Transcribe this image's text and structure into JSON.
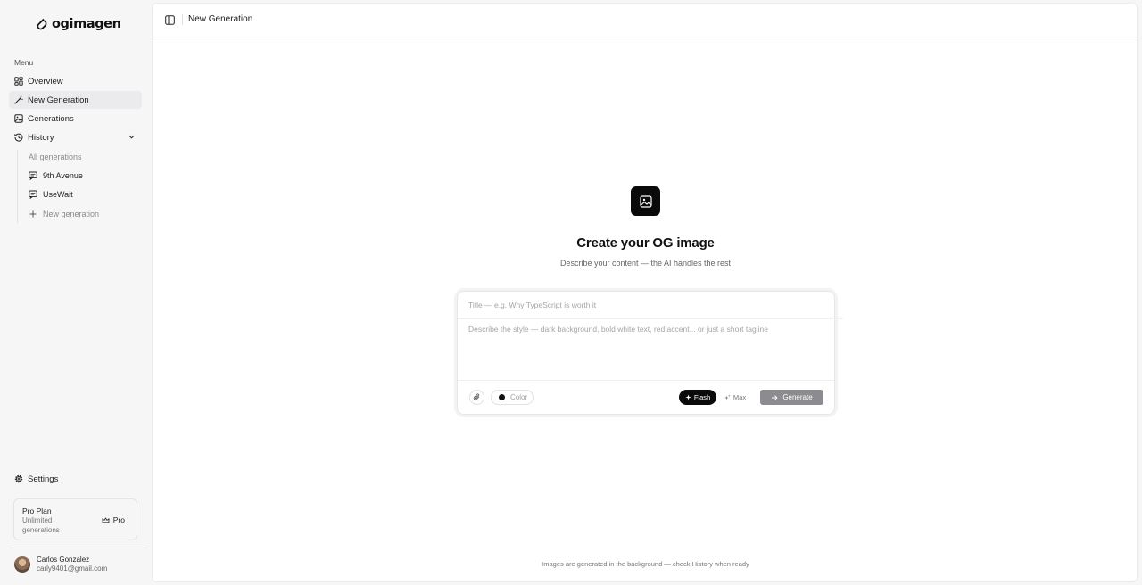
{
  "app": {
    "name": "ogimagen"
  },
  "sidebar": {
    "menu_label": "Menu",
    "items": [
      {
        "label": "Overview",
        "icon": "grid-icon"
      },
      {
        "label": "New Generation",
        "icon": "wand-icon",
        "active": true
      },
      {
        "label": "Generations",
        "icon": "image-icon"
      },
      {
        "label": "History",
        "icon": "history-icon",
        "expanded": true
      }
    ],
    "history": {
      "all_label": "All generations",
      "entries": [
        "9th Avenue",
        "UseWait"
      ],
      "new_label": "New generation"
    },
    "settings_label": "Settings",
    "plan": {
      "title": "Pro Plan",
      "description": "Unlimited generations",
      "badge": "Pro"
    },
    "user": {
      "name": "Carlos Gonzalez",
      "email": "carly9401@gmail.com"
    }
  },
  "topbar": {
    "title": "New Generation"
  },
  "hero": {
    "title": "Create your OG image",
    "subtitle": "Describe your content — the AI handles the rest"
  },
  "composer": {
    "title_placeholder": "Title — e.g. Why TypeScript is worth it",
    "style_placeholder": "Describe the style — dark background, bold white text, red accent... or just a short tagline",
    "color_label": "Color",
    "modes": {
      "flash": "Flash",
      "max": "Max",
      "selected": "Flash"
    },
    "generate_label": "Generate"
  },
  "footer_note": "Images are generated in the background — check History when ready",
  "colors": {
    "accent": "#0a0a0a",
    "sidebar_bg": "#f6f6f7",
    "main_bg": "#ffffff",
    "generate_disabled": "#8c8c90"
  }
}
